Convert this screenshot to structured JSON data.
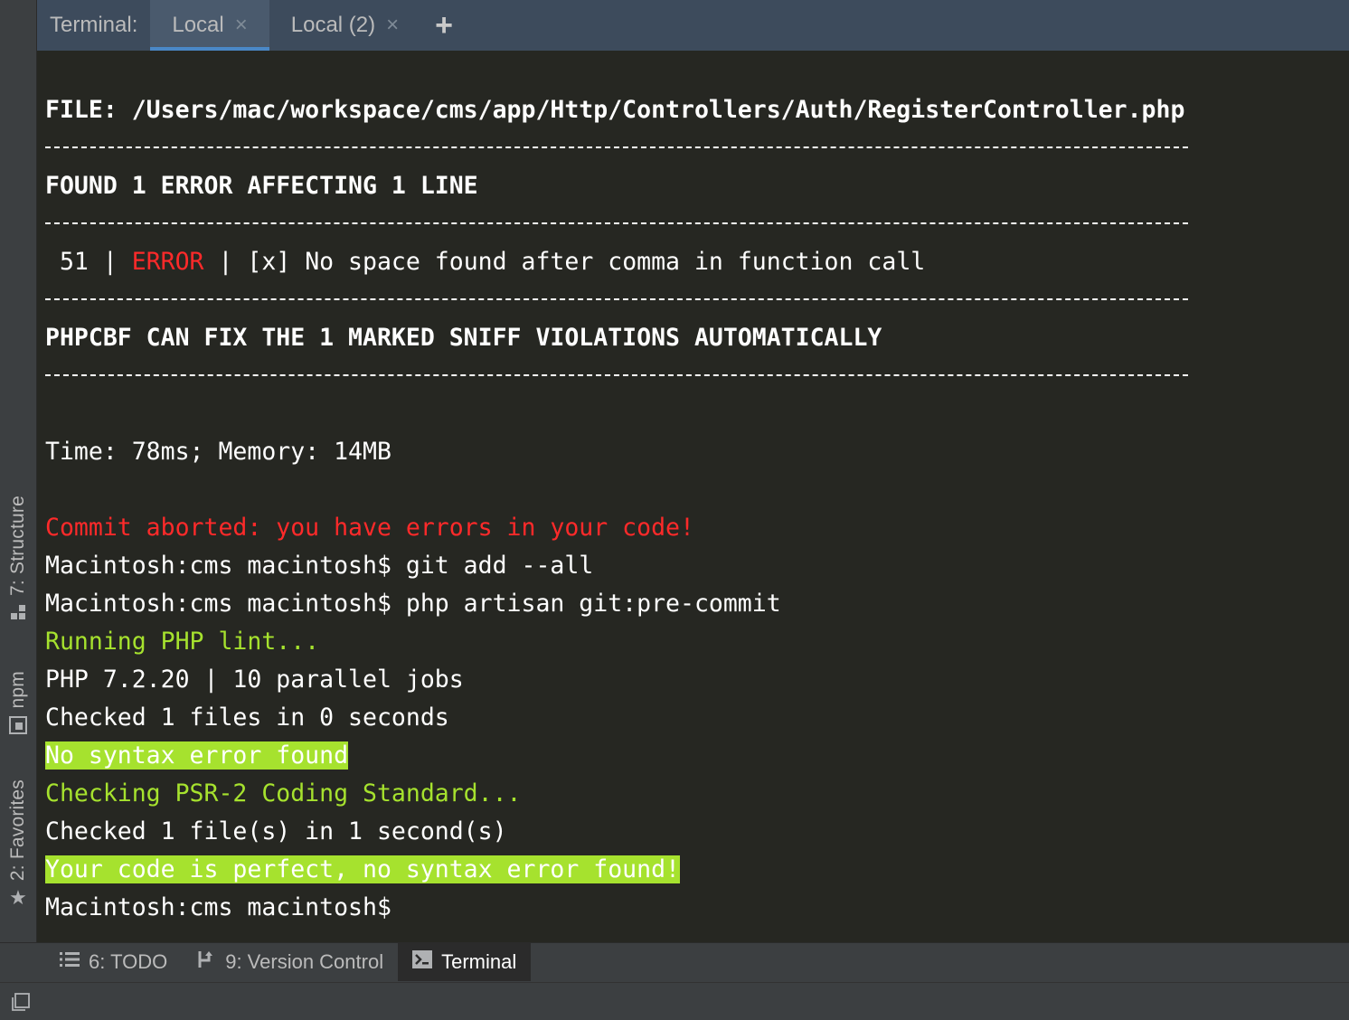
{
  "terminal": {
    "label": "Terminal:",
    "tabs": [
      {
        "label": "Local",
        "active": true
      },
      {
        "label": "Local (2)",
        "active": false
      }
    ],
    "add_tab": "+",
    "close_glyph": "×"
  },
  "left_tools": [
    {
      "label": "7: Structure",
      "icon": "structure-icon"
    },
    {
      "label": "npm",
      "icon": "npm-icon"
    },
    {
      "label": "2: Favorites",
      "icon": "star-icon"
    }
  ],
  "output": {
    "file_line": "FILE: /Users/mac/workspace/cms/app/Http/Controllers/Auth/RegisterController.php",
    "found_line": "FOUND 1 ERROR AFFECTING 1 LINE",
    "error_line_no": " 51 | ",
    "error_word": "ERROR",
    "error_msg": " | [x] No space found after comma in function call",
    "phpcbf_line": "PHPCBF CAN FIX THE 1 MARKED SNIFF VIOLATIONS AUTOMATICALLY",
    "time_line": "Time: 78ms; Memory: 14MB",
    "commit_aborted": "Commit aborted: you have errors in your code!",
    "cmd1": "Macintosh:cms macintosh$ git add --all",
    "cmd2": "Macintosh:cms macintosh$ php artisan git:pre-commit",
    "running_lint": "Running PHP lint...",
    "php_version": "PHP 7.2.20 | 10 parallel jobs",
    "checked_files": "Checked 1 files in 0 seconds",
    "no_syntax": "No syntax error found",
    "checking_psr": "Checking PSR-2 Coding Standard...",
    "checked_files2": "Checked 1 file(s) in 1 second(s)",
    "perfect": "Your code is perfect, no syntax error found!",
    "prompt": "Macintosh:cms macintosh$"
  },
  "bottom_tools": [
    {
      "label": "6: TODO",
      "icon": "todo-list-icon",
      "active": false
    },
    {
      "label": "9: Version Control",
      "icon": "version-control-icon",
      "active": false
    },
    {
      "label": "Terminal",
      "icon": "terminal-icon",
      "active": true
    }
  ],
  "colors": {
    "error_red": "#ff2a2a",
    "success_green": "#a6e22e",
    "terminal_bg": "#262722",
    "active_tab_accent": "#4a88c7"
  }
}
